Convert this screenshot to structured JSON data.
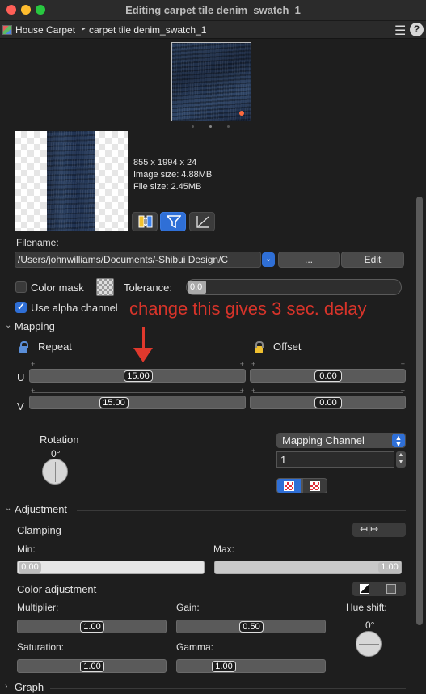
{
  "window": {
    "title": "Editing carpet tile denim_swatch_1"
  },
  "breadcrumb": {
    "root": "House Carpet",
    "separator": "▸",
    "current": "carpet tile denim_swatch_1"
  },
  "toolbar": {
    "menu_icon": "list-icon",
    "help": "?"
  },
  "texture": {
    "dimensions": "855 x 1994 x 24",
    "image_size": "Image size: 4.88MB",
    "file_size": "File size: 2.45MB",
    "icon_buttons": [
      "flip-icon",
      "filter-icon",
      "curve-icon"
    ]
  },
  "filename": {
    "label": "Filename:",
    "path": "/Users/johnwilliams/Documents/-Shibui Design/C",
    "browse_label": "...",
    "edit_label": "Edit"
  },
  "color_mask": {
    "label": "Color mask",
    "checked": false,
    "tolerance_label": "Tolerance:",
    "tolerance_value": "0.0"
  },
  "alpha": {
    "label": "Use alpha channel",
    "checked": true
  },
  "annotation": {
    "text": "change this gives 3 sec. delay",
    "color": "#d8342a"
  },
  "mapping": {
    "title": "Mapping",
    "repeat_label": "Repeat",
    "offset_label": "Offset",
    "u_label": "U",
    "v_label": "V",
    "repeat_u": "15.00",
    "repeat_v": "15.00",
    "offset_u": "0.00",
    "offset_v": "0.00",
    "rotation_label": "Rotation",
    "rotation_value": "0°",
    "channel_popup": "Mapping Channel",
    "channel_value": "1"
  },
  "adjustment": {
    "title": "Adjustment",
    "clamping_label": "Clamping",
    "min_label": "Min:",
    "max_label": "Max:",
    "min_value": "0.00",
    "max_value": "1.00",
    "color_adjustment_label": "Color adjustment",
    "multiplier_label": "Multiplier:",
    "multiplier_value": "1.00",
    "gain_label": "Gain:",
    "gain_value": "0.50",
    "hue_shift_label": "Hue shift:",
    "hue_shift_value": "0°",
    "saturation_label": "Saturation:",
    "saturation_value": "1.00",
    "gamma_label": "Gamma:",
    "gamma_value": "1.00"
  },
  "graph": {
    "title": "Graph"
  },
  "colors": {
    "accent": "#2f6fd6",
    "background": "#1e1e1e",
    "annotation_red": "#d8342a"
  }
}
